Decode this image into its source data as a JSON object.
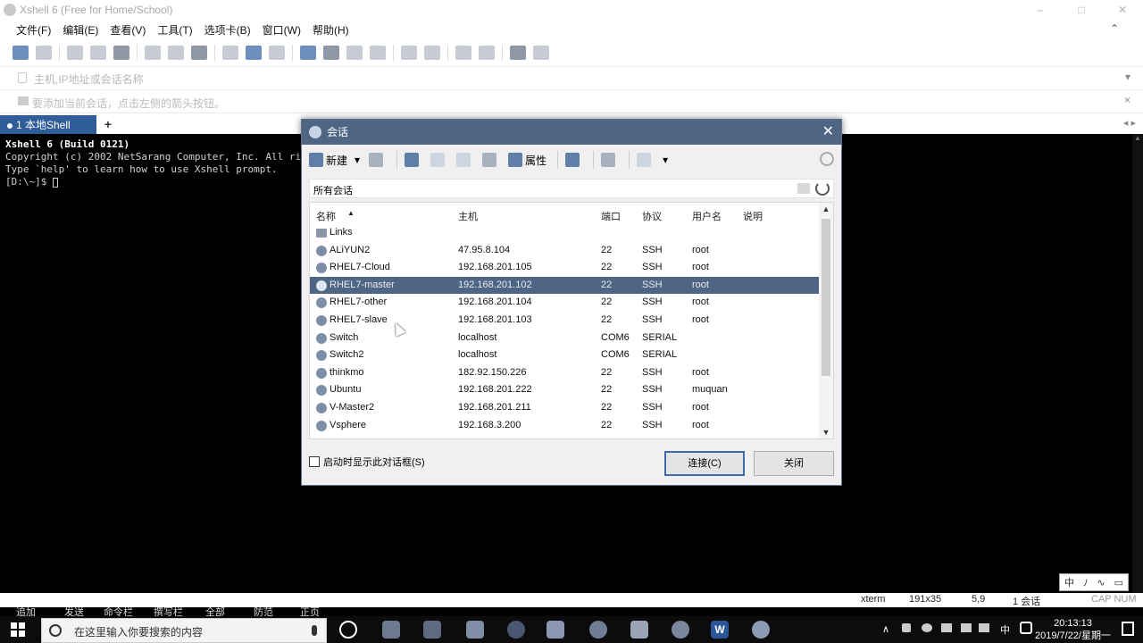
{
  "app": {
    "title": "Xshell 6 (Free for Home/School)",
    "window_controls": [
      "–",
      "□",
      "✕"
    ]
  },
  "menu": [
    "文件(F)",
    "编辑(E)",
    "查看(V)",
    "工具(T)",
    "选项卡(B)",
    "窗口(W)",
    "帮助(H)"
  ],
  "address_bar": {
    "placeholder": "主机,IP地址或会话名称"
  },
  "hint_bar": {
    "text": "要添加当前会话，点击左侧的箭头按钮。"
  },
  "tabs": [
    {
      "label": "1 本地Shell"
    }
  ],
  "tab_add": "+",
  "terminal": {
    "line1": "Xshell 6 (Build 0121)",
    "line2": "Copyright (c) 2002 NetSarang Computer, Inc. All ri",
    "line3": "",
    "line4": "Type `help' to learn how to use Xshell prompt.",
    "line5": "[D:\\~]$ "
  },
  "dialog": {
    "title": "会话",
    "toolbar": {
      "new_label": "新建",
      "properties_label": "属性"
    },
    "path": "所有会话",
    "columns": {
      "name": "名称",
      "host": "主机",
      "port": "端口",
      "protocol": "协议",
      "user": "用户名",
      "desc": "说明"
    },
    "rows": [
      {
        "name": "Links",
        "host": "",
        "port": "",
        "protocol": "",
        "user": "",
        "folder": true
      },
      {
        "name": "ALiYUN2",
        "host": "47.95.8.104",
        "port": "22",
        "protocol": "SSH",
        "user": "root"
      },
      {
        "name": "RHEL7-Cloud",
        "host": "192.168.201.105",
        "port": "22",
        "protocol": "SSH",
        "user": "root"
      },
      {
        "name": "RHEL7-master",
        "host": "192.168.201.102",
        "port": "22",
        "protocol": "SSH",
        "user": "root",
        "selected": true
      },
      {
        "name": "RHEL7-other",
        "host": "192.168.201.104",
        "port": "22",
        "protocol": "SSH",
        "user": "root"
      },
      {
        "name": "RHEL7-slave",
        "host": "192.168.201.103",
        "port": "22",
        "protocol": "SSH",
        "user": "root"
      },
      {
        "name": "Switch",
        "host": "localhost",
        "port": "COM6",
        "protocol": "SERIAL",
        "user": ""
      },
      {
        "name": "Switch2",
        "host": "localhost",
        "port": "COM6",
        "protocol": "SERIAL",
        "user": ""
      },
      {
        "name": "thinkmo",
        "host": "182.92.150.226",
        "port": "22",
        "protocol": "SSH",
        "user": "root"
      },
      {
        "name": "Ubuntu",
        "host": "192.168.201.222",
        "port": "22",
        "protocol": "SSH",
        "user": "muquan"
      },
      {
        "name": "V-Master2",
        "host": "192.168.201.211",
        "port": "22",
        "protocol": "SSH",
        "user": "root"
      },
      {
        "name": "Vsphere",
        "host": "192.168.3.200",
        "port": "22",
        "protocol": "SSH",
        "user": "root"
      }
    ],
    "show_on_startup_label": "启动时显示此对话框(S)",
    "connect_label": "连接(C)",
    "close_label": "关闭"
  },
  "statusbar": {
    "term": "xterm",
    "size": "191x35",
    "pos": "5,9",
    "sessions": "1 会话",
    "caps": "CAP NUM"
  },
  "bottom_tabs": [
    "追加",
    "发送",
    "命令栏",
    "撰写栏",
    "全部",
    "防范",
    "正页"
  ],
  "ime": [
    "中",
    "ﾉ",
    "∿",
    "▭"
  ],
  "taskbar": {
    "search_placeholder": "在这里输入你要搜索的内容",
    "tray_lang": "中",
    "time": "20:13:13",
    "date": "2019/7/22/星期一"
  },
  "colors": {
    "selection": "#4f6584",
    "tab_active": "#2f5d9a",
    "dialog_title": "#4f6584"
  }
}
